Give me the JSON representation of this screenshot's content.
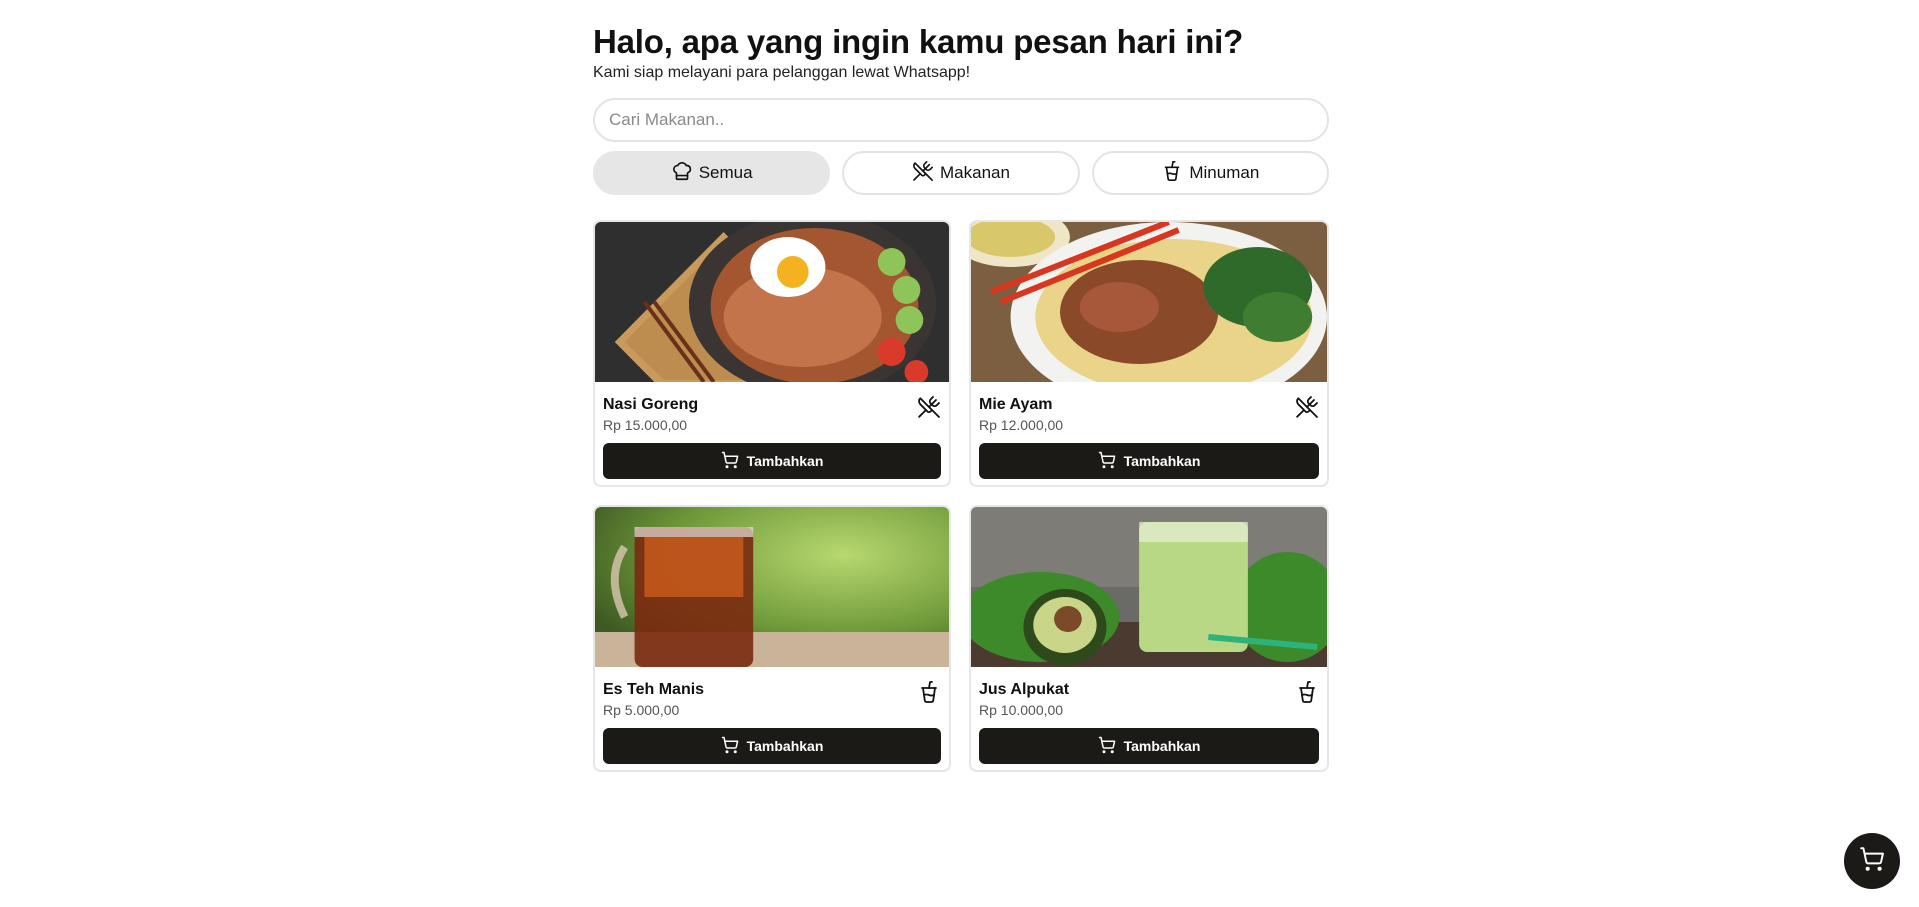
{
  "header": {
    "title": "Halo, apa yang ingin kamu pesan hari ini?",
    "subtitle": "Kami siap melayani para pelanggan lewat Whatsapp!"
  },
  "search": {
    "placeholder": "Cari Makanan..",
    "value": ""
  },
  "filters": [
    {
      "label": "Semua",
      "icon": "chef-hat-icon",
      "active": true
    },
    {
      "label": "Makanan",
      "icon": "utensils-crossed-icon",
      "active": false
    },
    {
      "label": "Minuman",
      "icon": "cup-icon",
      "active": false
    }
  ],
  "products": [
    {
      "name": "Nasi Goreng",
      "price": "Rp 15.000,00",
      "type_icon": "utensils-crossed-icon",
      "button_label": "Tambahkan",
      "button_icon": "cart-icon"
    },
    {
      "name": "Mie Ayam",
      "price": "Rp 12.000,00",
      "type_icon": "utensils-crossed-icon",
      "button_label": "Tambahkan",
      "button_icon": "cart-icon"
    },
    {
      "name": "Es Teh Manis",
      "price": "Rp 5.000,00",
      "type_icon": "cup-icon",
      "button_label": "Tambahkan",
      "button_icon": "cart-icon"
    },
    {
      "name": "Jus Alpukat",
      "price": "Rp 10.000,00",
      "type_icon": "cup-icon",
      "button_label": "Tambahkan",
      "button_icon": "cart-icon"
    }
  ],
  "cart_fab": {
    "icon": "cart-icon"
  },
  "colors": {
    "button_bg": "#1c1a17",
    "active_filter_bg": "#e6e6e6",
    "border": "#e3e3e3"
  }
}
